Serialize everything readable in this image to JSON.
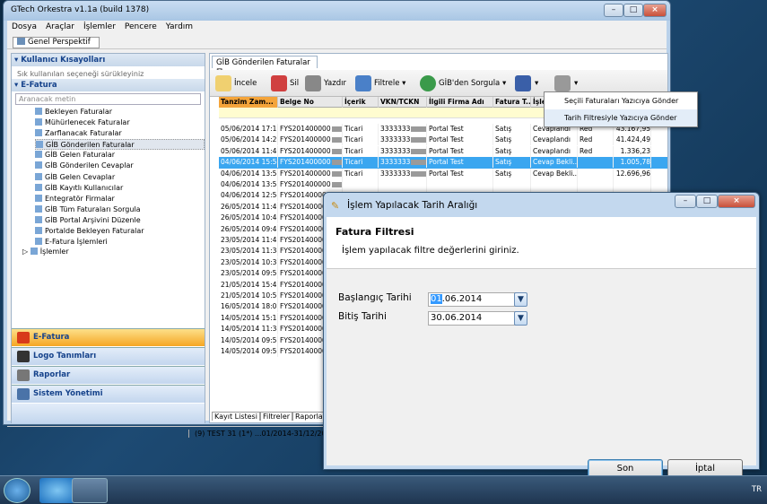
{
  "window": {
    "title": "GTech Orkestra v1.1a (build 1378)"
  },
  "menu": [
    "Dosya",
    "Araçlar",
    "İşlemler",
    "Pencere",
    "Yardım"
  ],
  "perspective": "Genel Perspektif",
  "left": {
    "shortcuts_title": "Kullanıcı Kısayolları",
    "shortcuts_hint": "Sık kullanılan seçeneği sürükleyiniz",
    "efatura_title": "E-Fatura",
    "search_placeholder": "Aranacak metin",
    "items": [
      "Bekleyen Faturalar",
      "Mühürlenecek Faturalar",
      "Zarflanacak Faturalar",
      "GİB Gönderilen Faturalar",
      "GİB Gelen Faturalar",
      "GİB Gönderilen Cevaplar",
      "GİB Gelen Cevaplar",
      "GİB Kayıtlı Kullanıcılar",
      "Entegratör Firmalar",
      "GİB Tüm Faturaları Sorgula",
      "GİB Portal Arşivini Düzenle",
      "Portalde Bekleyen Faturalar",
      "E-Fatura İşlemleri"
    ],
    "islemler": "İşlemler",
    "accordion": [
      "E-Fatura",
      "Logo Tanımları",
      "Raporlar",
      "Sistem Yönetimi"
    ]
  },
  "tab": {
    "title": "GİB Gönderilen Faturalar"
  },
  "toolbar": {
    "incele": "İncele",
    "sil": "Sil",
    "yazdir": "Yazdır",
    "filtrele": "Filtrele",
    "sorgula": "GİB'den Sorgula"
  },
  "grid": {
    "headers": [
      "Tanzim Zam...",
      "Belge No",
      "İçerik",
      "VKN/TCKN",
      "İlgili Firma Adı",
      "Fatura T...",
      "İşle"
    ],
    "rows": [
      [
        "05/06/2014 17:19",
        "FYS201400000",
        "Ticari",
        "3333333",
        "Portal Test",
        "Satış",
        "Cevaplandı",
        "Red",
        "43.167,95"
      ],
      [
        "05/06/2014 14:29",
        "FYS201400000",
        "Ticari",
        "3333333",
        "Portal Test",
        "Satış",
        "Cevaplandı",
        "Red",
        "41.424,49"
      ],
      [
        "05/06/2014 11:40",
        "FYS201400000",
        "Ticari",
        "3333333",
        "Portal Test",
        "Satış",
        "Cevaplandı",
        "Red",
        "1.336,23"
      ],
      [
        "04/06/2014 15:56",
        "FYS201400000",
        "Ticari",
        "3333333",
        "Portal Test",
        "Satış",
        "Cevap Bekli...",
        "",
        "1.005,78"
      ],
      [
        "04/06/2014 13:51",
        "FYS201400000",
        "Ticari",
        "3333333",
        "Portal Test",
        "Satış",
        "Cevap Bekli...",
        "",
        "12.696,96"
      ],
      [
        "04/06/2014 13:51",
        "FYS201400000",
        "",
        "",
        "",
        "",
        "",
        "",
        ""
      ],
      [
        "04/06/2014 12:54",
        "FYS201400000",
        "",
        "",
        "",
        "",
        "",
        "",
        ""
      ],
      [
        "26/05/2014 11:43",
        "FYS201400000",
        "",
        "",
        "",
        "",
        "",
        "",
        ""
      ],
      [
        "26/05/2014 10:44",
        "FYS201400000",
        "",
        "",
        "",
        "",
        "",
        "",
        ""
      ],
      [
        "26/05/2014 09:46",
        "FYS201400000",
        "",
        "",
        "",
        "",
        "",
        "",
        ""
      ],
      [
        "23/05/2014 11:42",
        "FYS201400000",
        "",
        "",
        "",
        "",
        "",
        "",
        ""
      ],
      [
        "23/05/2014 11:34",
        "FYS201400000",
        "",
        "",
        "",
        "",
        "",
        "",
        ""
      ],
      [
        "23/05/2014 10:30",
        "FYS201400000",
        "",
        "",
        "",
        "",
        "",
        "",
        ""
      ],
      [
        "23/05/2014 09:51",
        "FYS201400000",
        "",
        "",
        "",
        "",
        "",
        "",
        ""
      ],
      [
        "21/05/2014 15:41",
        "FYS201400000",
        "",
        "",
        "",
        "",
        "",
        "",
        ""
      ],
      [
        "21/05/2014 10:59",
        "FYS201400000",
        "",
        "",
        "",
        "",
        "",
        "",
        ""
      ],
      [
        "16/05/2014 18:05",
        "FYS201400000",
        "",
        "",
        "",
        "",
        "",
        "",
        ""
      ],
      [
        "14/05/2014 15:13",
        "FYS201400000",
        "",
        "",
        "",
        "",
        "",
        "",
        ""
      ],
      [
        "14/05/2014 11:34",
        "FYS201400000",
        "",
        "",
        "",
        "",
        "",
        "",
        ""
      ],
      [
        "14/05/2014 09:53",
        "FYS201400000",
        "",
        "",
        "",
        "",
        "",
        "",
        ""
      ],
      [
        "14/05/2014 09:52",
        "FYS201400000",
        "",
        "",
        "",
        "",
        "",
        "",
        ""
      ]
    ],
    "selected_index": 3
  },
  "bottom_tabs": [
    "Kayıt Listesi",
    "Filtreler",
    "Raporlar"
  ],
  "status": "(9) TEST 31  (1*) ...01/2014-31/12/2014",
  "context_menu": [
    "Seçili Faturaları Yazıcıya Gönder",
    "Tarih Filtresiyle Yazıcıya Gönder"
  ],
  "dialog": {
    "title": "İşlem Yapılacak Tarih Aralığı",
    "heading": "Fatura Filtresi",
    "subheading": "İşlem yapılacak filtre değerlerini giriniz.",
    "start_label": "Başlangıç Tarihi",
    "start_sel": "01",
    "start_rest": ".06.2014",
    "end_label": "Bitiş Tarihi",
    "end_value": "30.06.2014",
    "ok": "Son",
    "cancel": "İptal"
  },
  "tray": {
    "lang": "TR"
  }
}
